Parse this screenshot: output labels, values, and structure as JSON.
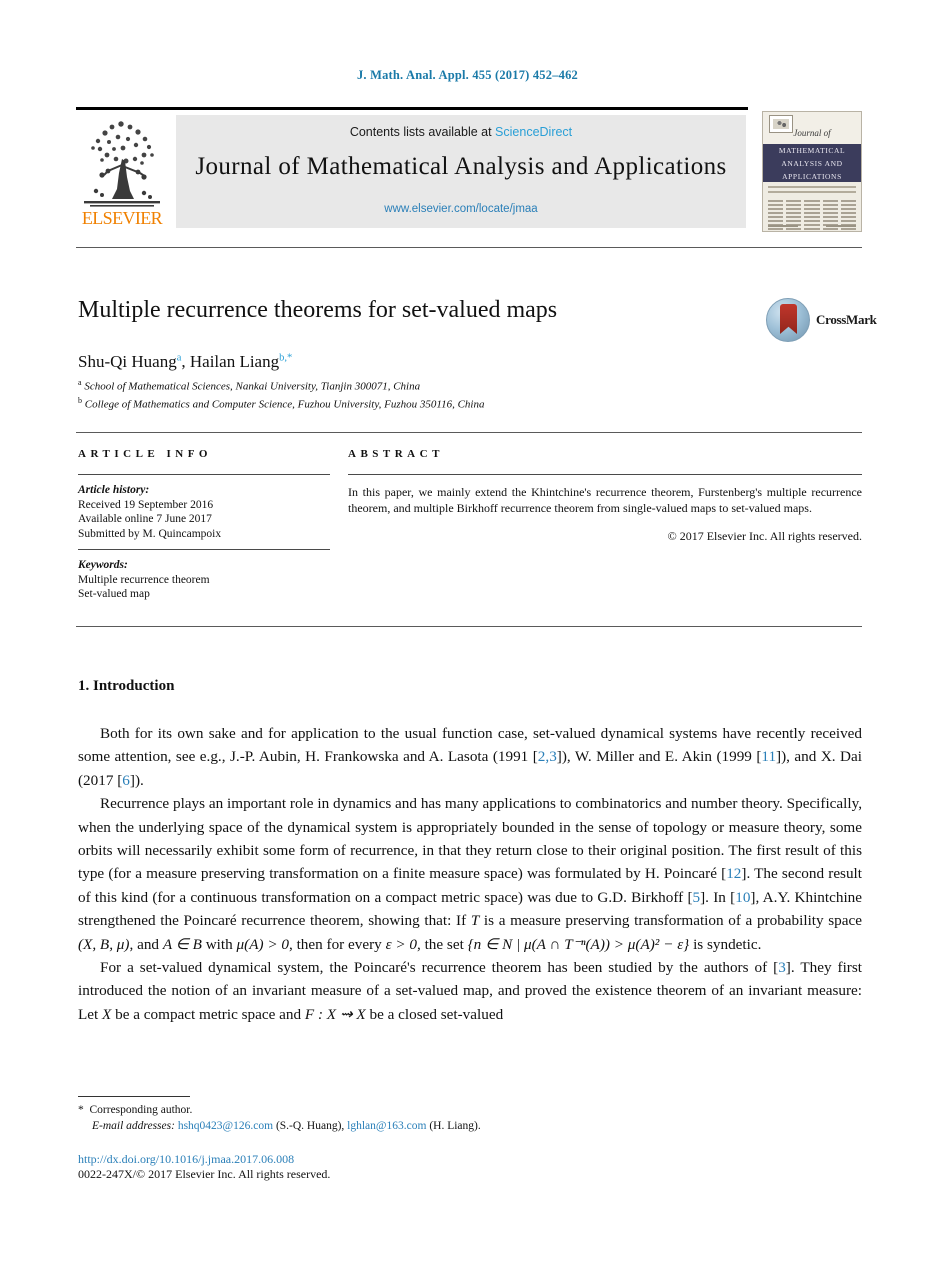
{
  "running_head": "J. Math. Anal. Appl. 455 (2017) 452–462",
  "masthead": {
    "contents_prefix": "Contents lists available at ",
    "sciencedirect": "ScienceDirect",
    "journal_title": "Journal of Mathematical Analysis and Applications",
    "journal_url": "www.elsevier.com/locate/jmaa",
    "publisher_wordmark": "ELSEVIER",
    "cover": {
      "journal_of": "Journal of",
      "line1": "MATHEMATICAL",
      "line2": "ANALYSIS AND",
      "line3": "APPLICATIONS"
    }
  },
  "article": {
    "title": "Multiple recurrence theorems for set-valued maps",
    "crossmark_label": "CrossMark",
    "authors": [
      {
        "name": "Shu-Qi Huang",
        "marks": "a"
      },
      {
        "name": "Hailan Liang",
        "marks": "b,*"
      }
    ],
    "affiliations": [
      {
        "mark": "a",
        "text": "School of Mathematical Sciences, Nankai University, Tianjin 300071, China"
      },
      {
        "mark": "b",
        "text": "College of Mathematics and Computer Science, Fuzhou University, Fuzhou 350116, China"
      }
    ]
  },
  "article_info": {
    "heading": "ARTICLE INFO",
    "history_label": "Article history:",
    "history": [
      "Received 19 September 2016",
      "Available online 7 June 2017",
      "Submitted by M. Quincampoix"
    ],
    "keywords_label": "Keywords:",
    "keywords": [
      "Multiple recurrence theorem",
      "Set-valued map"
    ]
  },
  "abstract": {
    "heading": "ABSTRACT",
    "text": "In this paper, we mainly extend the Khintchine's recurrence theorem, Furstenberg's multiple recurrence theorem, and multiple Birkhoff recurrence theorem from single-valued maps to set-valued maps.",
    "copyright": "© 2017 Elsevier Inc. All rights reserved."
  },
  "body": {
    "section_number_title": "1. Introduction",
    "paragraphs": [
      {
        "id": "p1",
        "segments": [
          {
            "t": "Both for its own sake and for application to the usual function case, set-valued dynamical systems have recently received some attention, see e.g., J.-P. Aubin, H. Frankowska and A. Lasota (1991 [",
            "k": "plain"
          },
          {
            "t": "2,3",
            "k": "ref"
          },
          {
            "t": "]), W. Miller and E. Akin (1999 [",
            "k": "plain"
          },
          {
            "t": "11",
            "k": "ref"
          },
          {
            "t": "]), and X. Dai (2017 [",
            "k": "plain"
          },
          {
            "t": "6",
            "k": "ref"
          },
          {
            "t": "]).",
            "k": "plain"
          }
        ]
      },
      {
        "id": "p2",
        "segments": [
          {
            "t": "Recurrence plays an important role in dynamics and has many applications to combinatorics and number theory. Specifically, when the underlying space of the dynamical system is appropriately bounded in the sense of topology or measure theory, some orbits will necessarily exhibit some form of recurrence, in that they return close to their original position. The first result of this type (for a measure preserving transformation on a finite measure space) was formulated by H. Poincaré [",
            "k": "plain"
          },
          {
            "t": "12",
            "k": "ref"
          },
          {
            "t": "]. The second result of this kind (for a continuous transformation on a compact metric space) was due to G.D. Birkhoff [",
            "k": "plain"
          },
          {
            "t": "5",
            "k": "ref"
          },
          {
            "t": "]. In [",
            "k": "plain"
          },
          {
            "t": "10",
            "k": "ref"
          },
          {
            "t": "], A.Y. Khintchine strengthened the Poincaré recurrence theorem, showing that: If ",
            "k": "plain"
          },
          {
            "t": "T",
            "k": "math"
          },
          {
            "t": " is a measure preserving transformation of a probability space ",
            "k": "plain"
          },
          {
            "t": "(X, B, μ)",
            "k": "math"
          },
          {
            "t": ", and ",
            "k": "plain"
          },
          {
            "t": "A ∈ B",
            "k": "math"
          },
          {
            "t": " with ",
            "k": "plain"
          },
          {
            "t": "μ(A) > 0",
            "k": "math"
          },
          {
            "t": ", then for every ",
            "k": "plain"
          },
          {
            "t": "ε > 0",
            "k": "math"
          },
          {
            "t": ", the set ",
            "k": "plain"
          },
          {
            "t": "{n ∈ N | μ(A ∩ T⁻ⁿ(A)) > μ(A)² − ε}",
            "k": "math"
          },
          {
            "t": " is syndetic.",
            "k": "plain"
          }
        ]
      },
      {
        "id": "p3",
        "segments": [
          {
            "t": "For a set-valued dynamical system, the Poincaré's recurrence theorem has been studied by the authors of [",
            "k": "plain"
          },
          {
            "t": "3",
            "k": "ref"
          },
          {
            "t": "]. They first introduced the notion of an invariant measure of a set-valued map, and proved the existence theorem of an invariant measure: Let ",
            "k": "plain"
          },
          {
            "t": "X",
            "k": "math"
          },
          {
            "t": " be a compact metric space and ",
            "k": "plain"
          },
          {
            "t": "F : X ⇝ X",
            "k": "math"
          },
          {
            "t": " be a closed set-valued",
            "k": "plain"
          }
        ]
      }
    ]
  },
  "footnotes": {
    "corresponding_mark": "*",
    "corresponding_text": "Corresponding author.",
    "email_label": "E-mail addresses:",
    "emails": [
      {
        "address": "hshq0423@126.com",
        "owner": "(S.-Q. Huang)"
      },
      {
        "address": "lghlan@163.com",
        "owner": "(H. Liang)"
      }
    ]
  },
  "footer": {
    "doi": "http://dx.doi.org/10.1016/j.jmaa.2017.06.008",
    "issn_line": "0022-247X/© 2017 Elsevier Inc. All rights reserved."
  },
  "colors": {
    "link": "#2a7fb8",
    "sciencedirect": "#2a9fd6",
    "elsevier_orange": "#f08000",
    "running_head": "#1a7aa8"
  }
}
